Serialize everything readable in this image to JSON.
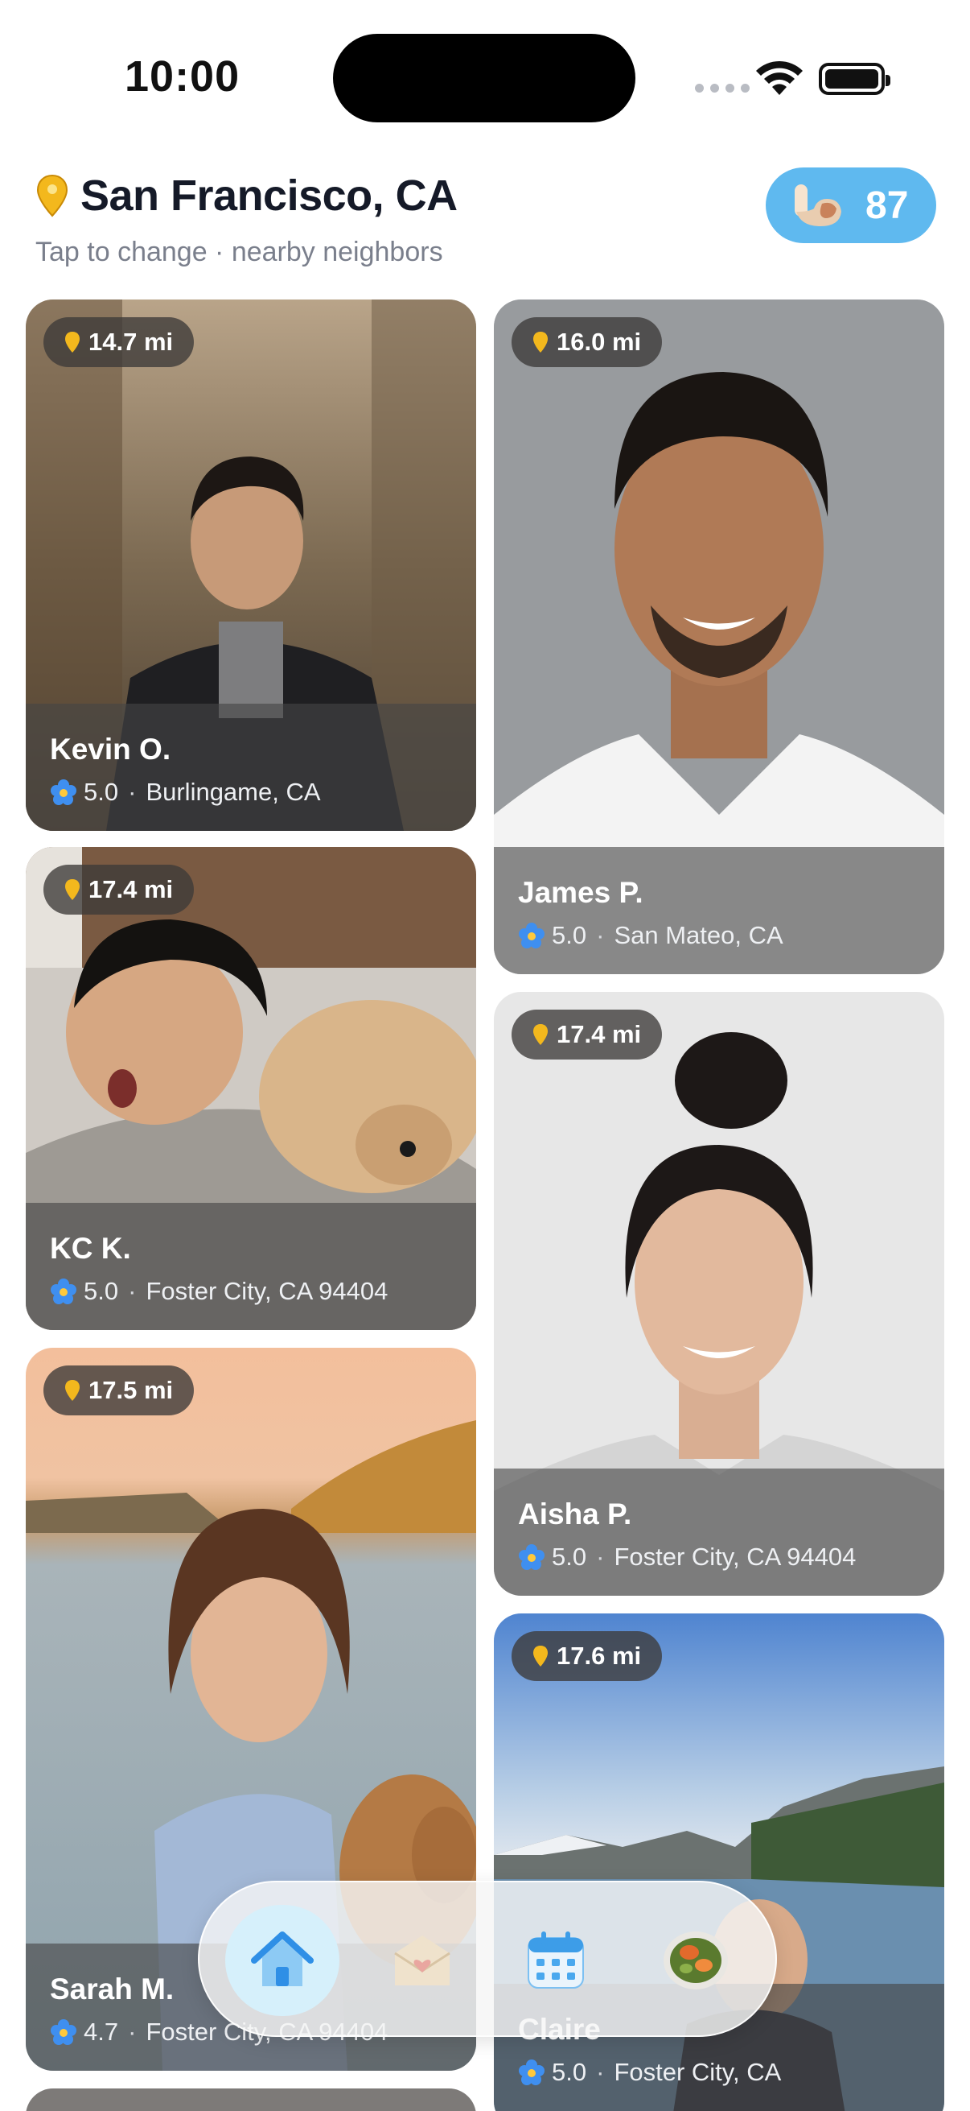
{
  "status_bar": {
    "time": "10:00"
  },
  "header": {
    "location": "San Francisco, CA",
    "subtitle": "Tap to change · nearby neighbors",
    "points": "87",
    "pin_icon": "location-pin-icon",
    "points_icon": "flexed-bicep-icon",
    "accent_color": "#5fb9ef"
  },
  "cards": [
    {
      "name": "Kevin O.",
      "rating": "5.0",
      "location": "Burlingame, CA",
      "distance": "14.7 mi"
    },
    {
      "name": "James P.",
      "rating": "5.0",
      "location": "San Mateo, CA",
      "distance": "16.0 mi"
    },
    {
      "name": "KC K.",
      "rating": "5.0",
      "location": "Foster City, CA 94404",
      "distance": "17.4 mi"
    },
    {
      "name": "Aisha P.",
      "rating": "5.0",
      "location": "Foster City, CA 94404",
      "distance": "17.4 mi"
    },
    {
      "name": "Sarah M.",
      "rating": "4.7",
      "location": "Foster City, CA 94404",
      "distance": "17.5 mi"
    },
    {
      "name": "Claire",
      "rating": "5.0",
      "location": "Foster City, CA",
      "distance": "17.6 mi"
    }
  ],
  "tabs": [
    {
      "icon": "home-icon",
      "active": true
    },
    {
      "icon": "envelope-heart-icon",
      "active": false
    },
    {
      "icon": "calendar-icon",
      "active": false
    },
    {
      "icon": "food-bowl-icon",
      "active": false
    }
  ]
}
